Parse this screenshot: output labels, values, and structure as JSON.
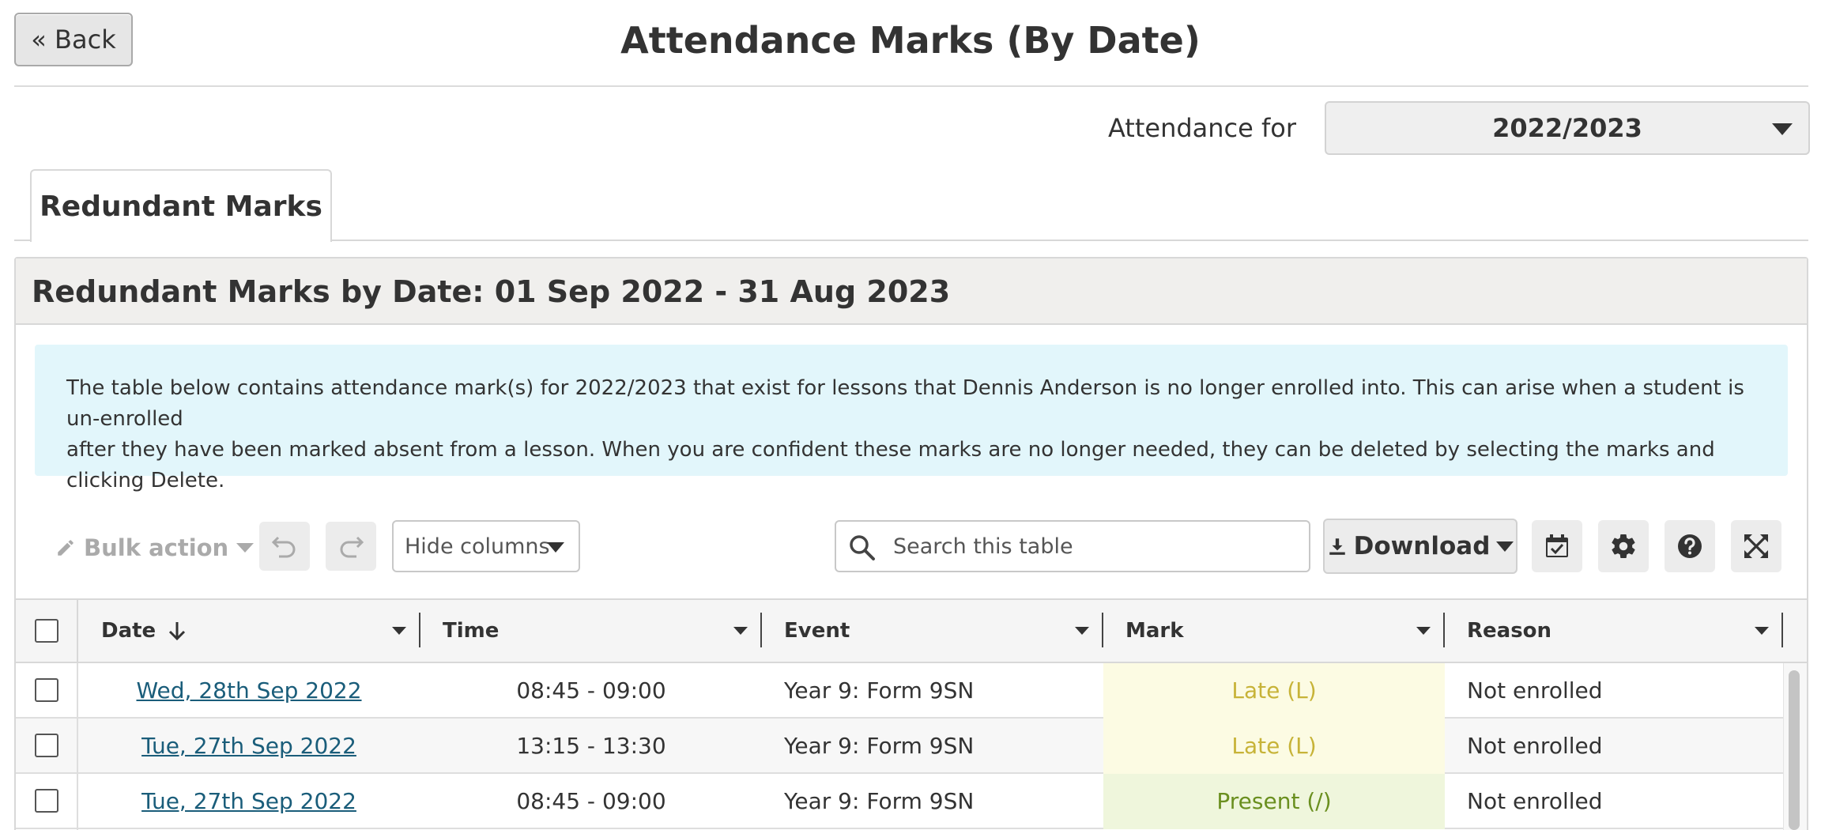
{
  "header": {
    "back_label": "« Back",
    "title": "Attendance Marks (By Date)"
  },
  "filter": {
    "label": "Attendance for",
    "selected_year": "2022/2023"
  },
  "tabs": [
    {
      "label": "Redundant Marks",
      "active": true
    }
  ],
  "panel": {
    "title": "Redundant Marks by Date: 01 Sep 2022 - 31 Aug 2023",
    "info_line1": "The table below contains attendance mark(s) for 2022/2023 that exist for lessons that Dennis Anderson is no longer enrolled into. This can arise when a student is un-enrolled",
    "info_line2": "after they have been marked absent from a lesson. When you are confident these marks are no longer needed, they can be deleted by selecting the marks and clicking Delete."
  },
  "toolbar": {
    "bulk_action_label": "Bulk action",
    "hide_columns_label": "Hide columns",
    "search_placeholder": "Search this table",
    "download_label": "Download"
  },
  "table": {
    "columns": {
      "date": "Date",
      "time": "Time",
      "event": "Event",
      "mark": "Mark",
      "reason": "Reason"
    },
    "rows": [
      {
        "date": "Wed, 28th Sep 2022",
        "time": "08:45 - 09:00",
        "event": "Year 9: Form 9SN",
        "mark": "Late (L)",
        "reason": "Not enrolled"
      },
      {
        "date": "Tue, 27th Sep 2022",
        "time": "13:15 - 13:30",
        "event": "Year 9: Form 9SN",
        "mark": "Late (L)",
        "reason": "Not enrolled"
      },
      {
        "date": "Tue, 27th Sep 2022",
        "time": "08:45 - 09:00",
        "event": "Year 9: Form 9SN",
        "mark": "Present (/)",
        "reason": "Not enrolled"
      }
    ]
  },
  "colors": {
    "late_bg": "#fcfbe3",
    "late_text": "#c7b338",
    "present_bg": "#eff6dc",
    "present_text": "#6a8f1f",
    "info_bg": "#e2f6fb",
    "link": "#1a5d7a"
  },
  "icons": [
    "pencil-icon",
    "undo-icon",
    "redo-icon",
    "search-icon",
    "download-icon",
    "calendar-check-icon",
    "gear-icon",
    "help-icon",
    "fullscreen-icon",
    "sort-down-icon"
  ]
}
